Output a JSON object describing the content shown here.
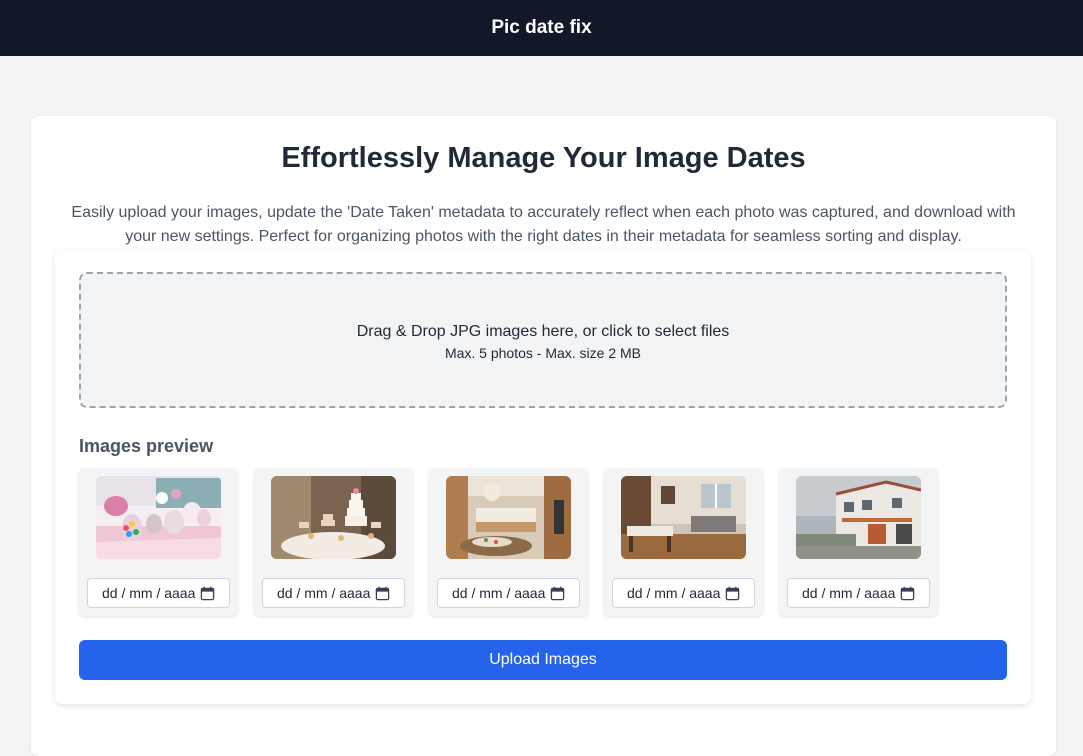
{
  "header": {
    "title": "Pic date fix"
  },
  "main": {
    "headline": "Effortlessly Manage Your Image Dates",
    "description": "Easily upload your images, update the 'Date Taken' metadata to accurately reflect when each photo was captured, and download with your new settings. Perfect for organizing photos with the right dates in their metadata for seamless sorting and display."
  },
  "dropzone": {
    "main_text": "Drag & Drop JPG images here, or click to select files",
    "sub_text": "Max. 5 photos - Max. size 2 MB"
  },
  "previews": {
    "title": "Images preview",
    "items": [
      {
        "image": "candy-table-photo",
        "date_placeholder": "dd / mm / aaaa"
      },
      {
        "image": "wedding-cakes-photo",
        "date_placeholder": "dd / mm / aaaa"
      },
      {
        "image": "kitchen-photo",
        "date_placeholder": "dd / mm / aaaa"
      },
      {
        "image": "living-room-photo",
        "date_placeholder": "dd / mm / aaaa"
      },
      {
        "image": "house-exterior-photo",
        "date_placeholder": "dd / mm / aaaa"
      }
    ]
  },
  "actions": {
    "upload_label": "Upload Images"
  },
  "colors": {
    "header_bg": "#111827",
    "page_bg": "#f3f4f6",
    "primary_button": "#2563eb"
  }
}
